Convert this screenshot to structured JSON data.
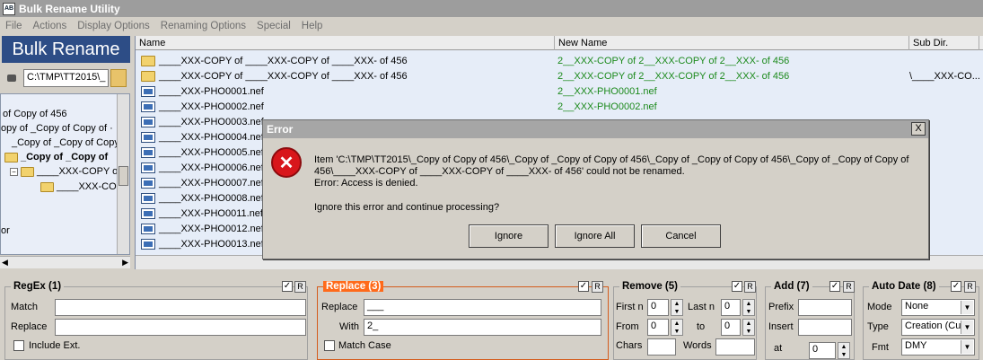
{
  "window": {
    "title": "Bulk Rename Utility",
    "app_icon": "AB"
  },
  "menu": [
    "File",
    "Actions",
    "Display Options",
    "Renaming Options",
    "Special",
    "Help"
  ],
  "brand": "Bulk Rename",
  "path": "C:\\TMP\\TT2015\\_",
  "tree": {
    "items": [
      "of Copy of 456",
      "opy of _Copy of Copy of ·",
      "_Copy of _Copy of Copy",
      "_Copy of _Copy of",
      "____XXX-COPY o",
      "____XXX-CO",
      "or"
    ]
  },
  "list": {
    "headers": {
      "name": "Name",
      "new_name": "New Name",
      "sub_dir": "Sub Dir."
    },
    "rows": [
      {
        "icon": "folder",
        "name": "____XXX-COPY of ____XXX-COPY of ____XXX- of 456",
        "new_name": "2__XXX-COPY of 2__XXX-COPY of 2__XXX- of 456",
        "sub_dir": ""
      },
      {
        "icon": "folder",
        "name": "____XXX-COPY of ____XXX-COPY of ____XXX- of 456",
        "new_name": "2__XXX-COPY of 2__XXX-COPY of 2__XXX- of 456",
        "sub_dir": "\\____XXX-CO..."
      },
      {
        "icon": "file",
        "name": "____XXX-PHO0001.nef",
        "new_name": "2__XXX-PHO0001.nef",
        "sub_dir": ""
      },
      {
        "icon": "file",
        "name": "____XXX-PHO0002.nef",
        "new_name": "2__XXX-PHO0002.nef",
        "sub_dir": ""
      },
      {
        "icon": "file",
        "name": "____XXX-PHO0003.nef",
        "new_name": "",
        "sub_dir": ""
      },
      {
        "icon": "file",
        "name": "____XXX-PHO0004.nef",
        "new_name": "",
        "sub_dir": ""
      },
      {
        "icon": "file",
        "name": "____XXX-PHO0005.nef",
        "new_name": "",
        "sub_dir": ""
      },
      {
        "icon": "file",
        "name": "____XXX-PHO0006.nef",
        "new_name": "",
        "sub_dir": ""
      },
      {
        "icon": "file",
        "name": "____XXX-PHO0007.nef",
        "new_name": "",
        "sub_dir": ""
      },
      {
        "icon": "file",
        "name": "____XXX-PHO0008.nef",
        "new_name": "",
        "sub_dir": ""
      },
      {
        "icon": "file",
        "name": "____XXX-PHO0011.nef",
        "new_name": "",
        "sub_dir": ""
      },
      {
        "icon": "file",
        "name": "____XXX-PHO0012.nef",
        "new_name": "",
        "sub_dir": ""
      },
      {
        "icon": "file",
        "name": "____XXX-PHO0013.nef",
        "new_name": "",
        "sub_dir": ""
      }
    ]
  },
  "dialog": {
    "title": "Error",
    "close": "X",
    "message_line1": "Item 'C:\\TMP\\TT2015\\_Copy of Copy of 456\\_Copy of _Copy of Copy of 456\\_Copy of _Copy of Copy of 456\\_Copy of _Copy of Copy of",
    "message_line2": "456\\____XXX-COPY of ____XXX-COPY of ____XXX- of 456' could not be renamed.",
    "message_line3": "Error: Access is denied.",
    "question": "Ignore this error and continue processing?",
    "buttons": [
      "Ignore",
      "Ignore All",
      "Cancel"
    ]
  },
  "panels": {
    "regex": {
      "title": "RegEx (1)",
      "match_label": "Match",
      "replace_label": "Replace",
      "match_value": "",
      "replace_value": "",
      "include_ext": "Include Ext."
    },
    "replace": {
      "title": "Replace (3)",
      "replace_label": "Replace",
      "with_label": "With",
      "replace_value": "___",
      "with_value": "2_",
      "match_case": "Match Case"
    },
    "remove": {
      "title": "Remove (5)",
      "first_n_label": "First n",
      "first_n": "0",
      "last_n_label": "Last n",
      "last_n": "0",
      "from_label": "From",
      "from": "0",
      "to_label": "to",
      "to": "0",
      "chars_label": "Chars",
      "words_label": "Words"
    },
    "add": {
      "title": "Add (7)",
      "prefix_label": "Prefix",
      "insert_label": "Insert",
      "at_label": "at",
      "at_value": "0"
    },
    "autodate": {
      "title": "Auto Date (8)",
      "mode_label": "Mode",
      "mode": "None",
      "type_label": "Type",
      "type": "Creation (Cur",
      "fmt_label": "Fmt",
      "fmt": "DMY"
    },
    "checked_mark": "✓",
    "r_label": "R"
  },
  "colors": {
    "accent_orange": "#ff6a1a",
    "brand_blue": "#2d4d86",
    "new_name_green": "#1c8a1c",
    "error_red": "#d8161b"
  }
}
